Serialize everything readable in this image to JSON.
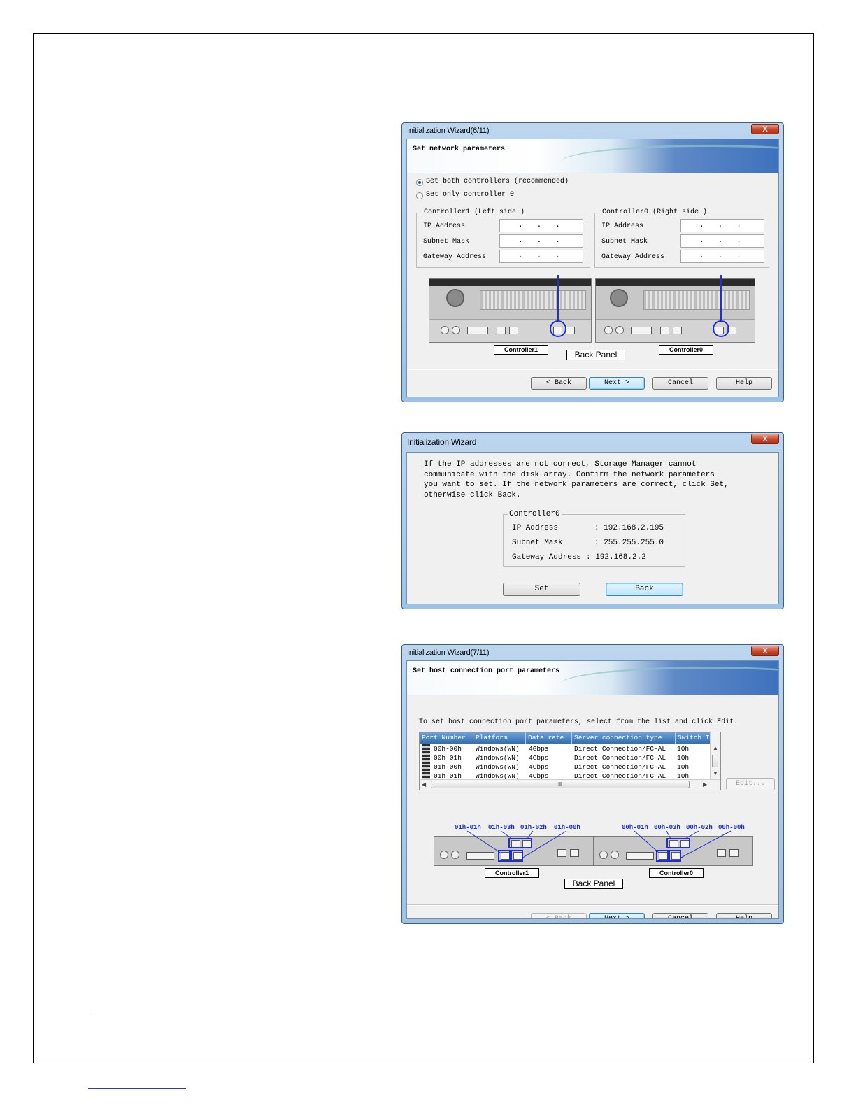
{
  "dialog1": {
    "title": "Initialization Wizard(6/11)",
    "close_label": "X",
    "banner": "Set network parameters",
    "radio_both": "Set both controllers  (recommended)",
    "radio_only0": "Set only controller 0",
    "left_group": "Controller1 (Left side )",
    "right_group": "Controller0 (Right side )",
    "ip_label": "IP Address",
    "subnet_label": "Subnet Mask",
    "gateway_label": "Gateway Address",
    "ip_placeholder": "...",
    "caption_c1": "Controller1",
    "caption_c0": "Controller0",
    "caption_panel": "Back Panel",
    "back_btn": "< Back",
    "next_btn": "Next >",
    "cancel_btn": "Cancel",
    "help_btn": "Help"
  },
  "dialog2": {
    "title": "Initialization Wizard",
    "close_label": "X",
    "message": "If the IP addresses are not correct, Storage Manager cannot\ncommunicate with the disk array. Confirm the network parameters\nyou want to set. If the network parameters are correct, click Set,\notherwise click Back.",
    "group": "Controller0",
    "ip_label": "IP Address",
    "ip_value": ":  192.168.2.195",
    "subnet_label": "Subnet Mask",
    "subnet_value": ":  255.255.255.0",
    "gateway_label": "Gateway Address",
    "gateway_value": ":  192.168.2.2",
    "set_btn": "Set",
    "back_btn": "Back"
  },
  "dialog3": {
    "title": "Initialization Wizard(7/11)",
    "close_label": "X",
    "banner": "Set host connection port parameters",
    "instruction": "To set host connection port parameters, select from the list and click Edit.",
    "columns": [
      "Port Number",
      "Platform",
      "Data rate",
      "Server connection type",
      "Switch I"
    ],
    "rows": [
      [
        "00h-00h",
        "Windows(WN)",
        "4Gbps",
        "Direct Connection/FC-AL",
        "10h"
      ],
      [
        "00h-01h",
        "Windows(WN)",
        "4Gbps",
        "Direct Connection/FC-AL",
        "10h"
      ],
      [
        "01h-00h",
        "Windows(WN)",
        "4Gbps",
        "Direct Connection/FC-AL",
        "10h"
      ],
      [
        "01h-01h",
        "Windows(WN)",
        "4Gbps",
        "Direct Connection/FC-AL",
        "10h"
      ]
    ],
    "scroll_mid": "III",
    "edit_btn": "Edit...",
    "port_labels_left": [
      "01h-01h",
      "01h-03h",
      "01h-02h",
      "01h-00h"
    ],
    "port_labels_right": [
      "00h-01h",
      "00h-03h",
      "00h-02h",
      "00h-00h"
    ],
    "caption_c1": "Controller1",
    "caption_c0": "Controller0",
    "caption_panel": "Back Panel",
    "back_btn": "< Back",
    "next_btn": "Next >",
    "cancel_btn": "Cancel",
    "help_btn": "Help"
  }
}
